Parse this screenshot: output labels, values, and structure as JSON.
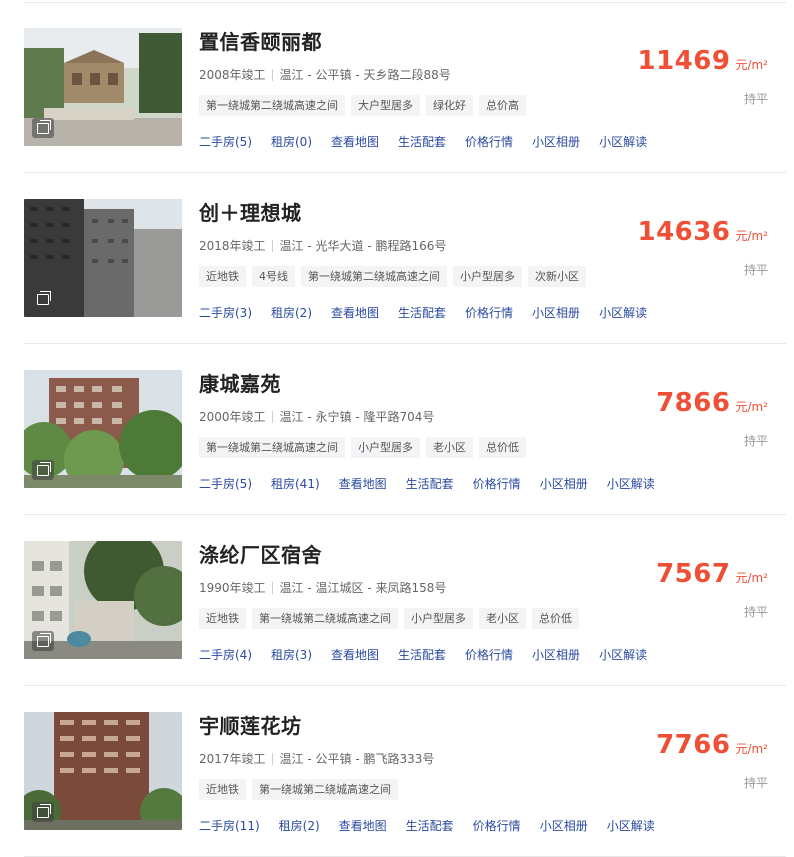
{
  "listings": [
    {
      "name": "置信香颐丽都",
      "year": "2008年竣工",
      "location": "温江 - 公平镇 - 天乡路二段88号",
      "tags": [
        "第一绕城第二绕城高速之间",
        "大户型居多",
        "绿化好",
        "总价高"
      ],
      "links": [
        "二手房(5)",
        "租房(0)",
        "查看地图",
        "生活配套",
        "价格行情",
        "小区相册",
        "小区解读"
      ],
      "price": "11469",
      "unit": "元/m²",
      "trend": "持平"
    },
    {
      "name": "创＋理想城",
      "year": "2018年竣工",
      "location": "温江 - 光华大道 - 鹏程路166号",
      "tags": [
        "近地铁",
        "4号线",
        "第一绕城第二绕城高速之间",
        "小户型居多",
        "次新小区"
      ],
      "links": [
        "二手房(3)",
        "租房(2)",
        "查看地图",
        "生活配套",
        "价格行情",
        "小区相册",
        "小区解读"
      ],
      "price": "14636",
      "unit": "元/m²",
      "trend": "持平"
    },
    {
      "name": "康城嘉苑",
      "year": "2000年竣工",
      "location": "温江 - 永宁镇 - 隆平路704号",
      "tags": [
        "第一绕城第二绕城高速之间",
        "小户型居多",
        "老小区",
        "总价低"
      ],
      "links": [
        "二手房(5)",
        "租房(41)",
        "查看地图",
        "生活配套",
        "价格行情",
        "小区相册",
        "小区解读"
      ],
      "price": "7866",
      "unit": "元/m²",
      "trend": "持平"
    },
    {
      "name": "涤纶厂区宿舍",
      "year": "1990年竣工",
      "location": "温江 - 温江城区 - 来凤路158号",
      "tags": [
        "近地铁",
        "第一绕城第二绕城高速之间",
        "小户型居多",
        "老小区",
        "总价低"
      ],
      "links": [
        "二手房(4)",
        "租房(3)",
        "查看地图",
        "生活配套",
        "价格行情",
        "小区相册",
        "小区解读"
      ],
      "price": "7567",
      "unit": "元/m²",
      "trend": "持平"
    },
    {
      "name": "宇顺莲花坊",
      "year": "2017年竣工",
      "location": "温江 - 公平镇 - 鹏飞路333号",
      "tags": [
        "近地铁",
        "第一绕城第二绕城高速之间"
      ],
      "links": [
        "二手房(11)",
        "租房(2)",
        "查看地图",
        "生活配套",
        "价格行情",
        "小区相册",
        "小区解读"
      ],
      "price": "7766",
      "unit": "元/m²",
      "trend": "持平"
    }
  ],
  "icons": {
    "album": "photo-album-icon"
  },
  "colors": {
    "price": "#ef4f36",
    "link": "#2b4aa0",
    "tag_bg": "#f3f4f6"
  }
}
